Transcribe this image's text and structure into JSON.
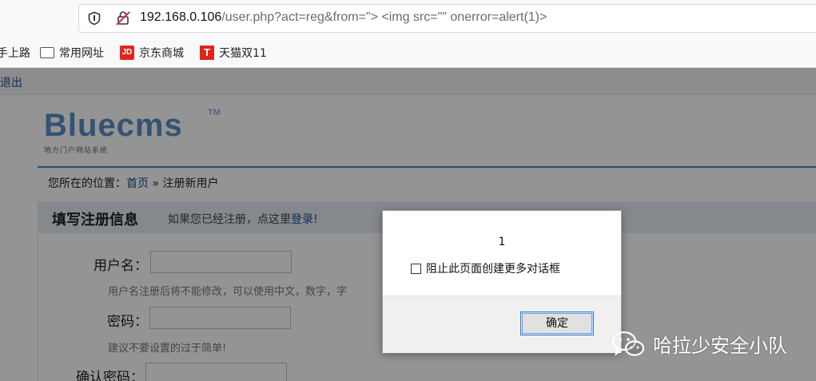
{
  "browser": {
    "url_host": "192.168.0.106",
    "url_rest": "/user.php?act=reg&from=\"> <img src=\"\" onerror=alert(1)>",
    "bookmarks": [
      {
        "label": "手上路",
        "icon": "none"
      },
      {
        "label": "常用网址",
        "icon": "folder-icon"
      },
      {
        "label": "京东商城",
        "icon": "jd-icon"
      },
      {
        "label": "天猫双11",
        "icon": "tmall-icon"
      }
    ]
  },
  "site": {
    "logout": "退出",
    "logo": "Bluecms",
    "logo_tm": "TM",
    "logo_sub": "地方门户网站系统",
    "breadcrumb": {
      "prefix": "您所在的位置：",
      "home": "首页",
      "sep": " » ",
      "current": "注册新用户"
    },
    "panel": {
      "title": "填写注册信息",
      "tip_text": "如果您已经注册，点这里",
      "tip_link": "登录",
      "tip_end": "!"
    },
    "form": {
      "username_label": "用户名：",
      "username_hint": "用户名注册后将不能修改，可以使用中文，数字，字",
      "password_label": "密码：",
      "password_hint": "建议不要设置的过于简单!",
      "confirm_label": "确认密码："
    }
  },
  "dialog": {
    "message": "1",
    "checkbox_label": "阻止此页面创建更多对话框",
    "checkbox_checked": false,
    "ok_label": "确定"
  },
  "watermark": {
    "text": "哈拉少安全小队",
    "icon": "wechat-icon"
  }
}
